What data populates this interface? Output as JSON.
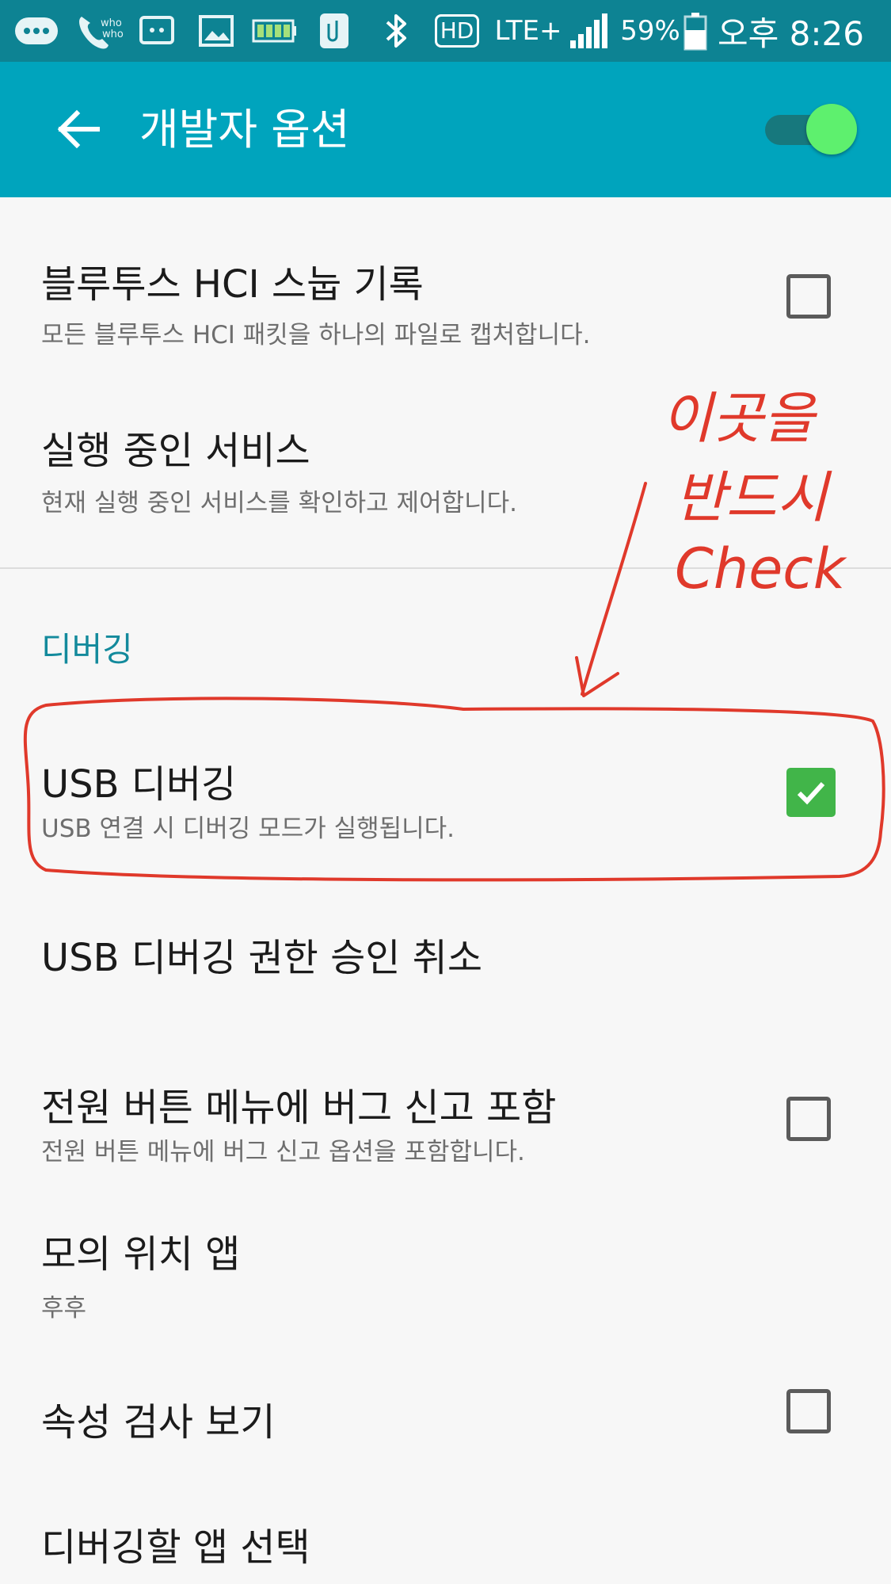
{
  "status_bar": {
    "hd_label": "HD",
    "network_label": "LTE+",
    "battery_percent": "59%",
    "time": "오후 8:26"
  },
  "app_bar": {
    "title": "개발자 옵션",
    "master_switch_on": true
  },
  "settings": [
    {
      "title": "블루투스 HCI 스눕 기록",
      "subtitle": "모든 블루투스 HCI 패킷을 하나의 파일로 캡처합니다.",
      "checked": false
    },
    {
      "title": "실행 중인 서비스",
      "subtitle": "현재 실행 중인 서비스를 확인하고 제어합니다."
    }
  ],
  "debug_section": {
    "header": "디버깅",
    "items": [
      {
        "title": "USB 디버깅",
        "subtitle": "USB 연결 시 디버깅 모드가 실행됩니다.",
        "checked": true
      },
      {
        "title": "USB 디버깅 권한 승인 취소"
      },
      {
        "title": "전원 버튼 메뉴에 버그 신고 포함",
        "subtitle": "전원 버튼 메뉴에 버그 신고 옵션을 포함합니다.",
        "checked": false
      },
      {
        "title": "모의 위치 앱",
        "subtitle": "후후"
      },
      {
        "title": "속성 검사 보기",
        "checked": false
      },
      {
        "title": "디버깅할 앱 선택"
      }
    ]
  },
  "annotation": {
    "line1": "이곳을",
    "line2": "반드시",
    "line3": "Check",
    "color": "#e0392b"
  },
  "colors": {
    "status_bar": "#0d8393",
    "app_bar": "#00a4bd",
    "accent": "#138a9c",
    "checkbox_checked": "#41b549"
  }
}
